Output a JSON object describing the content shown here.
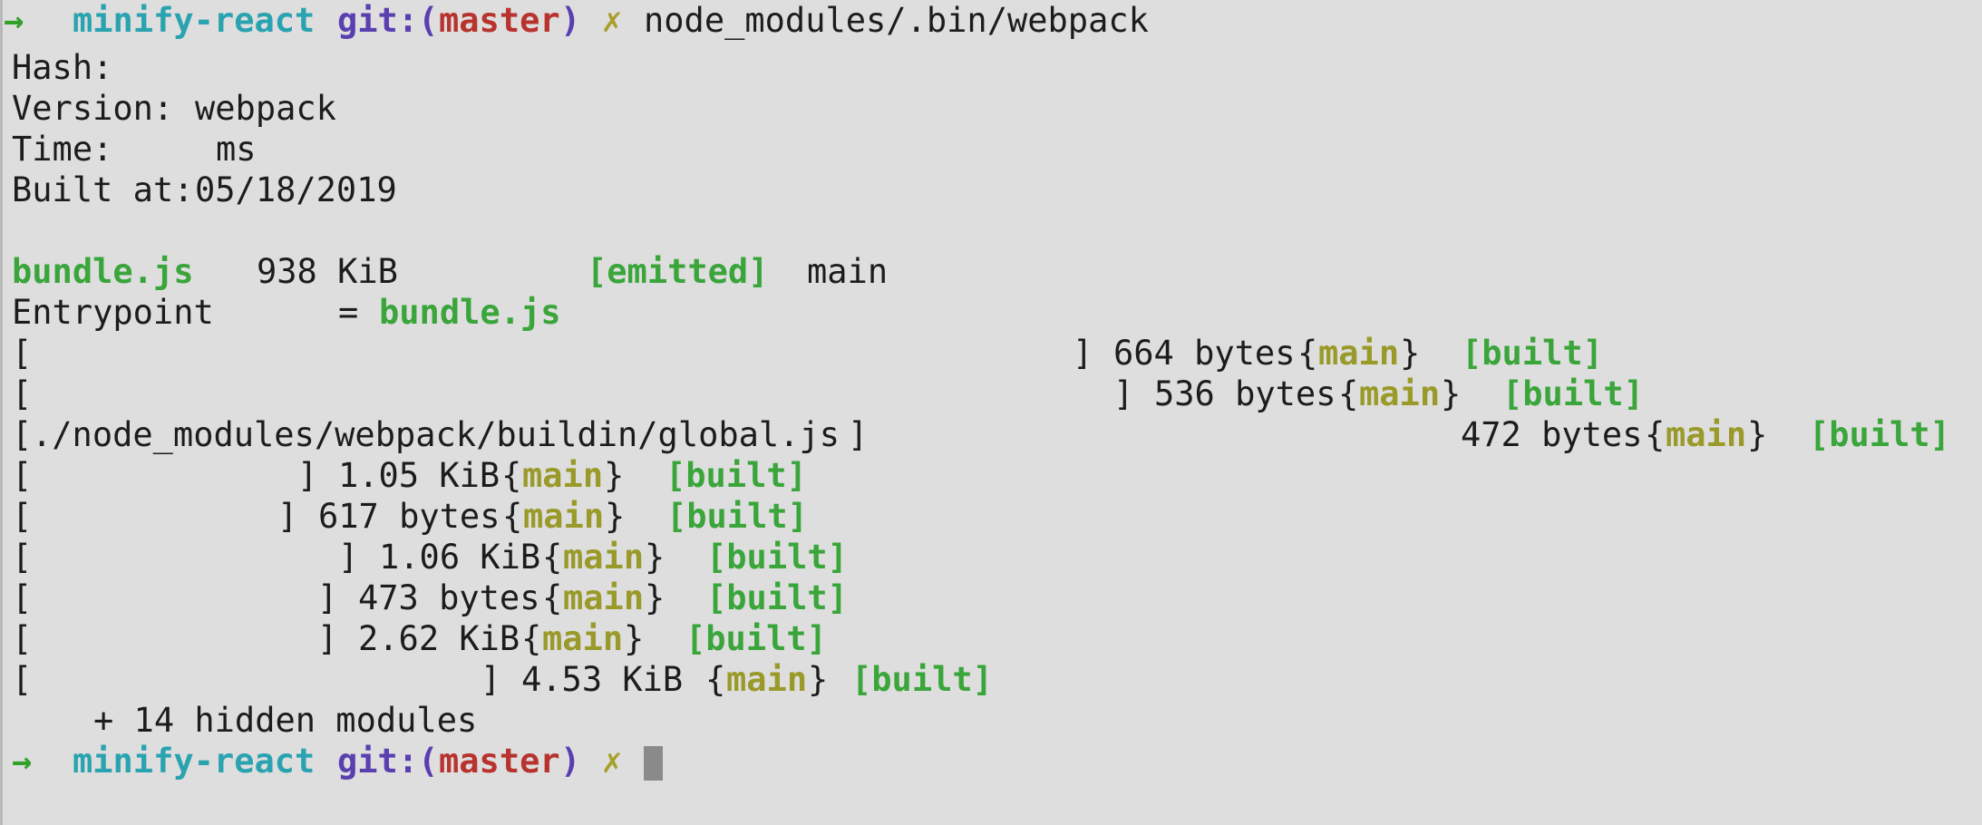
{
  "prompt": {
    "arrow": "→",
    "directory": "minify-react",
    "git_prefix": "git:(",
    "branch": "master",
    "git_suffix": ")",
    "dirty_mark": "✗",
    "command": "node_modules/.bin/webpack"
  },
  "summary": {
    "hash_label": "Hash:",
    "version_label": "Version:",
    "version_value": "webpack",
    "time_label": "Time:",
    "time_unit": "ms",
    "built_at_label": "Built at:",
    "built_at_value": "05/18/2019"
  },
  "asset": {
    "name": "bundle.js",
    "size": "938 KiB",
    "status": "[emitted]",
    "chunk": "main"
  },
  "entrypoint": {
    "label": "Entrypoint",
    "equals": "=",
    "value": "bundle.js"
  },
  "modules": [
    {
      "open": "[",
      "name": "",
      "close": "]",
      "size": "664 bytes",
      "chunk": "main",
      "status": "[built]"
    },
    {
      "open": "[",
      "name": "",
      "close": "]",
      "size": "536 bytes",
      "chunk": "main",
      "status": "[built]"
    },
    {
      "open": "[",
      "name": "./node_modules/webpack/buildin/global.js",
      "close": "]",
      "size": "472 bytes",
      "chunk": "main",
      "status": "[built]"
    },
    {
      "open": "[",
      "name": "",
      "close": "]",
      "size": "1.05 KiB",
      "chunk": "main",
      "status": "[built]"
    },
    {
      "open": "[",
      "name": "",
      "close": "]",
      "size": "617 bytes",
      "chunk": "main",
      "status": "[built]"
    },
    {
      "open": "[",
      "name": "",
      "close": "]",
      "size": "1.06 KiB",
      "chunk": "main",
      "status": "[built]"
    },
    {
      "open": "[",
      "name": "",
      "close": "]",
      "size": "473 bytes",
      "chunk": "main",
      "status": "[built]"
    },
    {
      "open": "[",
      "name": "",
      "close": "]",
      "size": "2.62 KiB",
      "chunk": "main",
      "status": "[built]"
    },
    {
      "open": "[",
      "name": "",
      "close": "]",
      "size": "4.53 KiB",
      "chunk": "main",
      "status": "[built]"
    }
  ],
  "hidden_modules": "+ 14 hidden modules",
  "final_prompt": {
    "arrow": "→",
    "directory": "minify-react",
    "git_prefix": "git:(",
    "branch": "master",
    "git_suffix": ")",
    "dirty_mark": "✗"
  },
  "colors": {
    "background": "#dedede",
    "text": "#1c1c1c",
    "arrow": "#34a02a",
    "directory": "#2aa3b0",
    "git": "#5a3fb0",
    "branch": "#b8332e",
    "dirty": "#a8a02a",
    "emitted": "#3aa53a",
    "chunk": "#9a9a2a",
    "cursor": "#8a8a8a"
  }
}
